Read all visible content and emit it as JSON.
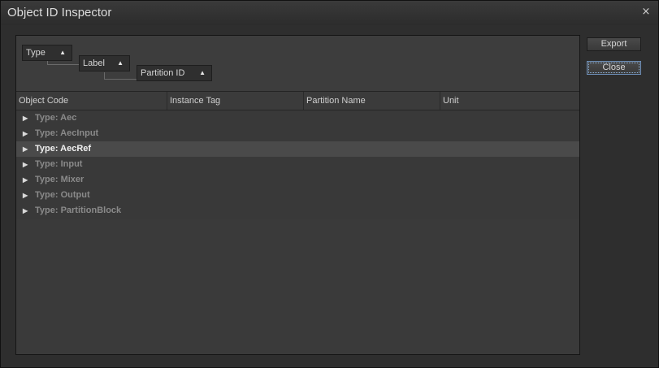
{
  "window": {
    "title": "Object ID Inspector",
    "close_glyph": "×"
  },
  "grouping": {
    "chips": [
      {
        "label": "Type",
        "sort_icon": "sort-ascending-icon"
      },
      {
        "label": "Label",
        "sort_icon": "sort-ascending-icon"
      },
      {
        "label": "Partition ID",
        "sort_icon": "sort-ascending-icon"
      }
    ]
  },
  "table": {
    "columns": [
      "Object Code",
      "Instance Tag",
      "Partition Name",
      "Unit"
    ],
    "rows": [
      {
        "label": "Type: Aec",
        "selected": false
      },
      {
        "label": "Type: AecInput",
        "selected": false
      },
      {
        "label": "Type: AecRef",
        "selected": true
      },
      {
        "label": "Type: Input",
        "selected": false
      },
      {
        "label": "Type: Mixer",
        "selected": false
      },
      {
        "label": "Type: Output",
        "selected": false
      },
      {
        "label": "Type: PartitionBlock",
        "selected": false
      }
    ]
  },
  "buttons": {
    "export_label": "Export",
    "close_label": "Close"
  }
}
